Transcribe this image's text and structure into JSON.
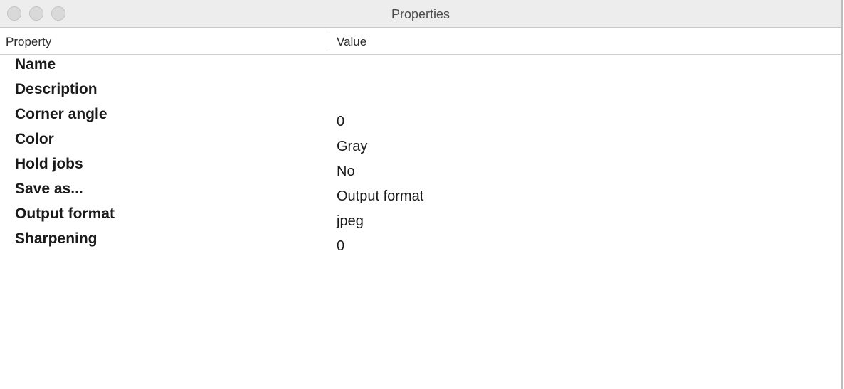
{
  "window": {
    "title": "Properties"
  },
  "table": {
    "columns": [
      "Property",
      "Value"
    ],
    "rows": [
      {
        "property": "Name",
        "value": ""
      },
      {
        "property": "Description",
        "value": ""
      },
      {
        "property": "Corner angle",
        "value": "0"
      },
      {
        "property": "Color",
        "value": "Gray"
      },
      {
        "property": "Hold jobs",
        "value": "No"
      },
      {
        "property": "Save as...",
        "value": "Output format"
      },
      {
        "property": "Output format",
        "value": "jpeg"
      },
      {
        "property": "Sharpening",
        "value": "0"
      }
    ]
  }
}
